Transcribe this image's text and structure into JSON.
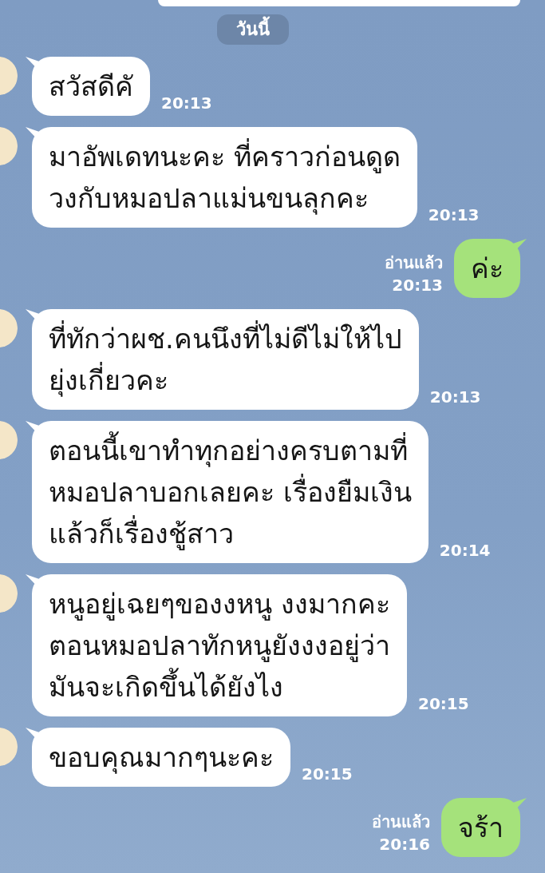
{
  "date_divider": "วันนี้",
  "messages": [
    {
      "kind": "incoming",
      "text": "สวัสดีคั",
      "time": "20:13"
    },
    {
      "kind": "incoming",
      "text": "มาอัพเดทนะคะ ที่คราวก่อนดูด\nวงกับหมอปลาแม่นขนลุกคะ",
      "time": "20:13"
    },
    {
      "kind": "outgoing",
      "text": "ค่ะ",
      "read": "อ่านแล้ว",
      "time": "20:13"
    },
    {
      "kind": "incoming",
      "text": "ที่ทักว่าผช.คนนึงที่ไม่ดีไม่ให้ไป\nยุ่งเกี่ยวคะ",
      "time": "20:13"
    },
    {
      "kind": "incoming",
      "text": "ตอนนี้เขาทำทุกอย่างครบตามที่\nหมอปลาบอกเลยคะ เรื่องยืมเงิน\nแล้วก็เรื่องชู้สาว",
      "time": "20:14"
    },
    {
      "kind": "incoming",
      "text": "หนูอยู่เฉยๆของงหนู งงมากคะ\nตอนหมอปลาทักหนูยังงงอยู่ว่า\nมันจะเกิดขึ้นได้ยังไง",
      "time": "20:15"
    },
    {
      "kind": "incoming",
      "text": "ขอบคุณมากๆนะคะ",
      "time": "20:15"
    },
    {
      "kind": "outgoing",
      "text": "จร้า",
      "read": "อ่านแล้ว",
      "time": "20:16"
    }
  ]
}
